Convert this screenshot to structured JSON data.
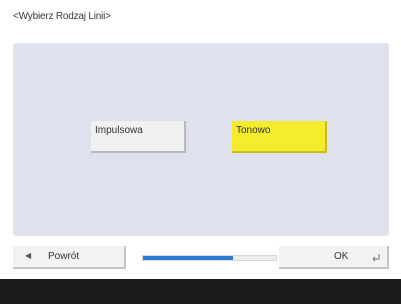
{
  "screen": {
    "title": "<Wybierz Rodzaj Linii>"
  },
  "options": [
    {
      "label": "Impulsowa",
      "selected": false
    },
    {
      "label": "Tonowo",
      "selected": true
    }
  ],
  "navigation": {
    "back_label": "Powrót",
    "back_icon": "left-arrow-icon",
    "ok_label": "OK",
    "ok_icon": "enter-return-icon",
    "progress_percent": 68
  },
  "colors": {
    "selected_option": "#f4ec2d",
    "panel_background": "#dfe2ec",
    "progress_fill": "#2a7bd4",
    "footer_bar": "#1a1a1a"
  }
}
